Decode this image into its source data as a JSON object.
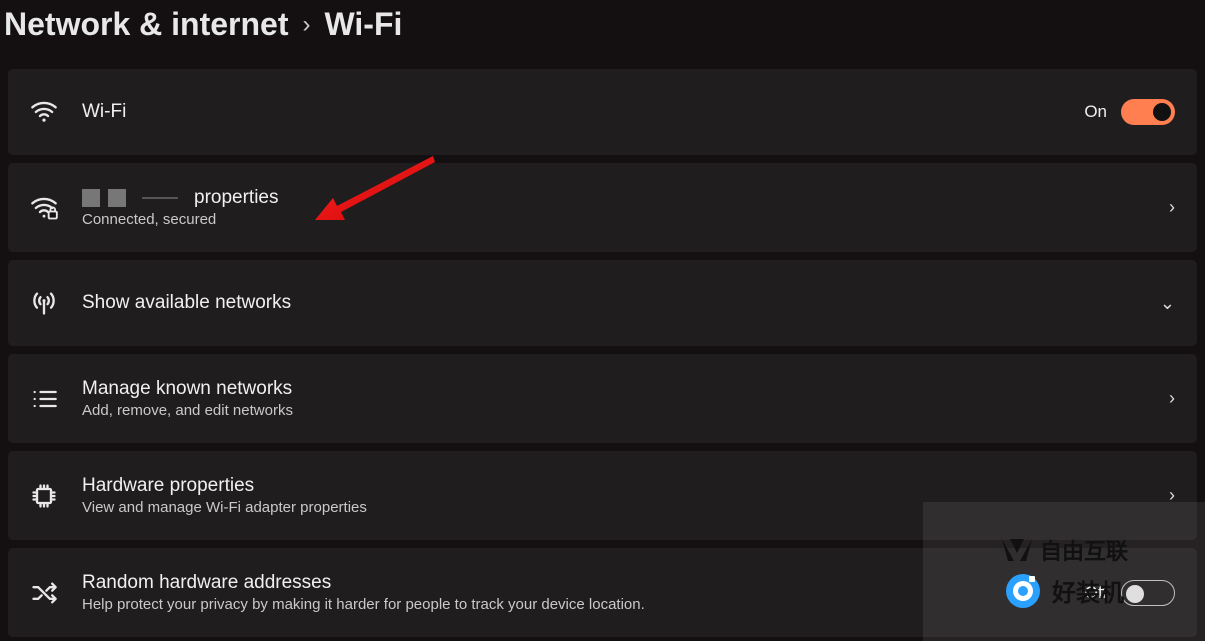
{
  "breadcrumb": {
    "parent": "Network & internet",
    "current": "Wi-Fi"
  },
  "cards": {
    "wifi_toggle": {
      "title": "Wi-Fi",
      "state_label": "On",
      "state": "on"
    },
    "connected": {
      "title_suffix": "properties",
      "sub": "Connected, secured"
    },
    "available": {
      "title": "Show available networks"
    },
    "manage": {
      "title": "Manage known networks",
      "sub": "Add, remove, and edit networks"
    },
    "hardware": {
      "title": "Hardware properties",
      "sub": "View and manage Wi-Fi adapter properties"
    },
    "random": {
      "title": "Random hardware addresses",
      "sub": "Help protect your privacy by making it harder for people to track your device location.",
      "state_label": "Off",
      "state": "off"
    }
  },
  "watermark": {
    "line1": "自由互联",
    "line2": "好装机"
  },
  "colors": {
    "toggle_on": "#ff7f50"
  }
}
